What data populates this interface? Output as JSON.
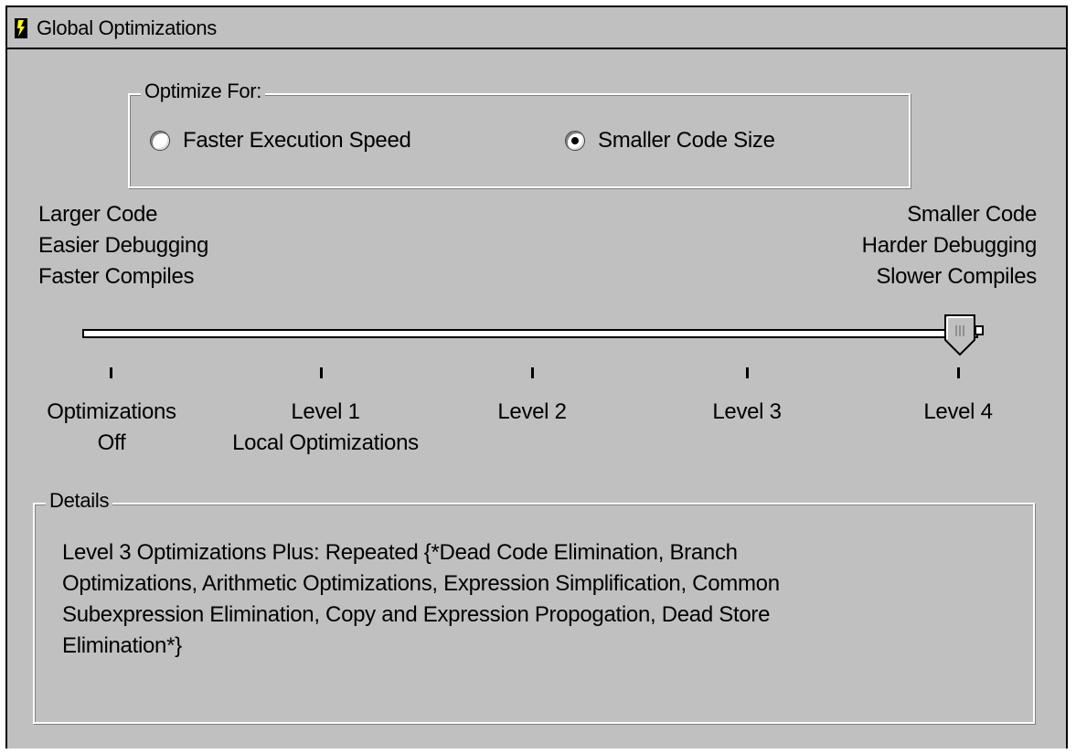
{
  "window": {
    "title": "Global Optimizations"
  },
  "optimize_for": {
    "legend": "Optimize For:",
    "options": [
      {
        "label": "Faster Execution Speed",
        "selected": false
      },
      {
        "label": "Smaller Code Size",
        "selected": true
      }
    ]
  },
  "tradeoffs": {
    "left": [
      "Larger Code",
      "Easier Debugging",
      "Faster Compiles"
    ],
    "right": [
      "Smaller Code",
      "Harder Debugging",
      "Slower Compiles"
    ]
  },
  "slider": {
    "selected_index": 4,
    "levels": [
      {
        "line1": "Optimizations",
        "line2": "Off"
      },
      {
        "line1": "Level 1",
        "line2": "Local Optimizations"
      },
      {
        "line1": "Level 2",
        "line2": ""
      },
      {
        "line1": "Level 3",
        "line2": ""
      },
      {
        "line1": "Level 4",
        "line2": ""
      }
    ]
  },
  "details": {
    "legend": "Details",
    "lines": [
      "Level 3 Optimizations Plus:  Repeated {*Dead Code Elimination, Branch",
      "Optimizations, Arithmetic Optimizations, Expression Simplification, Common",
      "Subexpression Elimination, Copy and Expression Propogation, Dead Store",
      "Elimination*}"
    ]
  }
}
